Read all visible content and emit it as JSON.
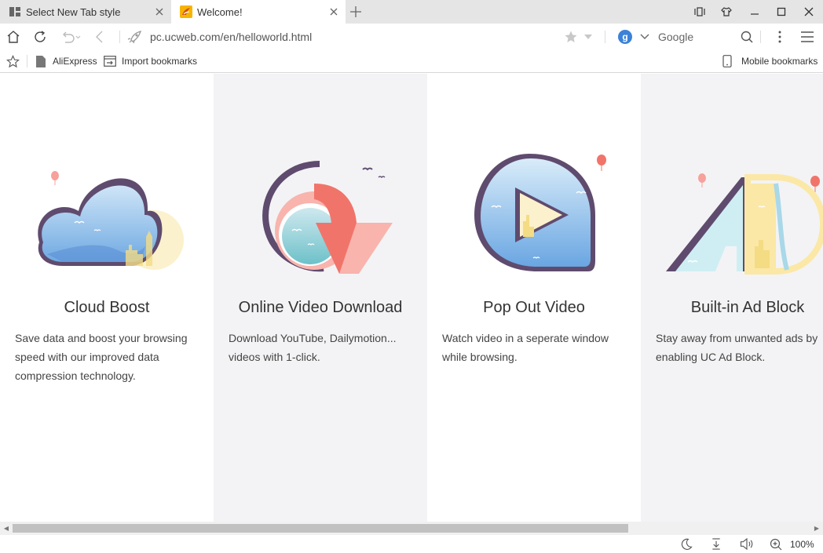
{
  "tabs": [
    {
      "title": "Select New Tab style",
      "active": false,
      "icon": "grid-layout-icon"
    },
    {
      "title": "Welcome!",
      "active": true,
      "icon": "uc-browser-icon"
    }
  ],
  "address": {
    "url": "pc.ucweb.com/en/helloworld.html"
  },
  "search": {
    "engine": "Google"
  },
  "bookmarks": {
    "items": [
      {
        "label": "AliExpress",
        "icon": "page-icon"
      },
      {
        "label": "Import bookmarks",
        "icon": "import-icon"
      }
    ],
    "mobile": "Mobile bookmarks"
  },
  "features": [
    {
      "title": "Cloud Boost",
      "desc": "Save data and boost your browsing speed with our improved data compression technology."
    },
    {
      "title": "Online Video Download",
      "desc": "Download YouTube, Dailymotion... videos with 1-click."
    },
    {
      "title": "Pop Out Video",
      "desc": "Watch video in a seperate window while browsing."
    },
    {
      "title": "Built-in Ad Block",
      "desc": "Stay away from unwanted ads by enabling UC Ad Block."
    }
  ],
  "status": {
    "zoom": "100%"
  },
  "colors": {
    "accent_blue": "#3b82d8",
    "sky_blue": "#8cc0ec",
    "coral": "#f1746a",
    "cream": "#fbf1cc",
    "outline": "#5f4b6e"
  }
}
